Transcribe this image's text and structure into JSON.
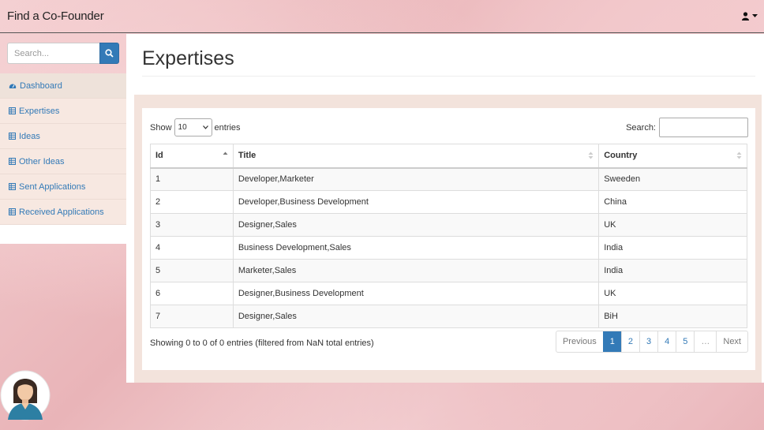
{
  "app": {
    "title": "Find a Co-Founder"
  },
  "header": {
    "user_icon": "user-icon",
    "caret_icon": "caret-down-icon"
  },
  "sidebar": {
    "search_placeholder": "Search...",
    "search_icon": "search-icon",
    "items": [
      {
        "label": "Dashboard",
        "icon": "dashboard-icon"
      },
      {
        "label": "Expertises",
        "icon": "table-icon"
      },
      {
        "label": "Ideas",
        "icon": "table-icon"
      },
      {
        "label": "Other Ideas",
        "icon": "table-icon"
      },
      {
        "label": "Sent Applications",
        "icon": "table-icon"
      },
      {
        "label": "Received Applications",
        "icon": "table-icon"
      }
    ]
  },
  "main": {
    "title": "Expertises",
    "show_label": "Show",
    "entries_value": "10",
    "entries_label": "entries",
    "search_label": "Search:",
    "columns": [
      "Id",
      "Title",
      "Country"
    ],
    "rows": [
      [
        "1",
        "Developer,Marketer",
        "Sweeden"
      ],
      [
        "2",
        "Developer,Business Development",
        "China"
      ],
      [
        "3",
        "Designer,Sales",
        "UK"
      ],
      [
        "4",
        "Business Development,Sales",
        "India"
      ],
      [
        "5",
        "Marketer,Sales",
        "India"
      ],
      [
        "6",
        "Designer,Business Development",
        "UK"
      ],
      [
        "7",
        "Designer,Sales",
        "BiH"
      ]
    ],
    "info": "Showing 0 to 0 of 0 entries (filtered from NaN total entries)",
    "pagination": {
      "previous": "Previous",
      "pages": [
        "1",
        "2",
        "3",
        "4",
        "5"
      ],
      "ellipsis": "…",
      "next": "Next",
      "current": "1"
    }
  },
  "colors": {
    "accent": "#337ab7",
    "panel": "#f3e3dc"
  }
}
